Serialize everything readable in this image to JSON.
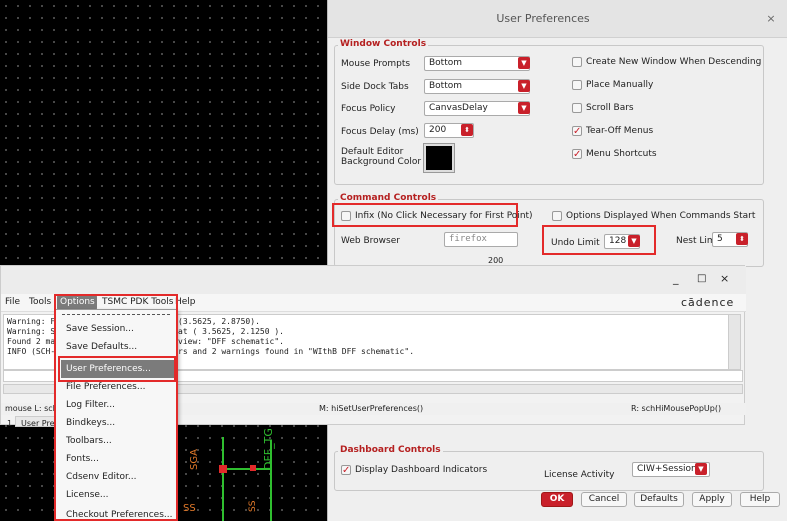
{
  "prefs": {
    "title": "User Preferences",
    "close": "×",
    "window_controls": {
      "title": "Window Controls",
      "mouse_prompts": {
        "label": "Mouse Prompts",
        "value": "Bottom"
      },
      "side_dock_tabs": {
        "label": "Side Dock Tabs",
        "value": "Bottom"
      },
      "focus_policy": {
        "label": "Focus Policy",
        "value": "CanvasDelay"
      },
      "focus_delay": {
        "label": "Focus Delay (ms)",
        "value": "200"
      },
      "bg_color": {
        "label1": "Default Editor",
        "label2": "Background Color"
      },
      "create_new_window": "Create New Window When Descending",
      "place_manually": "Place Manually",
      "scroll_bars": "Scroll Bars",
      "tear_off_menus": "Tear-Off Menus",
      "menu_shortcuts": "Menu Shortcuts"
    },
    "command_controls": {
      "title": "Command Controls",
      "infix": "Infix (No Click Necessary for First Point)",
      "options_displayed": "Options Displayed When Commands Start",
      "web_browser": {
        "label": "Web Browser",
        "value": "firefox"
      },
      "undo_limit": {
        "label": "Undo Limit",
        "value": "128"
      },
      "nest_limit": {
        "label": "Nest Limit",
        "value": "5"
      },
      "slider_value": "200"
    },
    "dashboard_controls": {
      "title": "Dashboard Controls",
      "display_indicators": "Display Dashboard Indicators",
      "license_activity": {
        "label": "License Activity",
        "value": "CIW+Session"
      }
    },
    "buttons": {
      "ok": "OK",
      "cancel": "Cancel",
      "defaults": "Defaults",
      "apply": "Apply",
      "help": "Help"
    }
  },
  "ciw": {
    "win_min": "_",
    "win_max": "□",
    "win_close": "×",
    "menus": [
      "File",
      "Tools",
      "Options",
      "TSMC PDK Tools",
      "Help"
    ],
    "brand": "cādence",
    "log": [
      "Warning: F",
      "Warning: S",
      "Found 2 ma",
      "INFO (SCH-"
    ],
    "log_right": [
      "(3.5625, 2.8750).",
      "at ( 3.5625, 2.1250 ).",
      "view: \"DFF schematic\".",
      "rs and 2 warnings found in \"WIthB DFF schematic\"."
    ],
    "status_left": "mouse L: sch",
    "status_mid": "M: hiSetUserPreferences()",
    "status_right": "R: schHiMousePopUp()",
    "tab_num": "1",
    "tab_label": "User Pref"
  },
  "options_menu": {
    "items": [
      "Save Session...",
      "Save Defaults...",
      "User Preferences...",
      "File Preferences...",
      "Log Filter...",
      "Bindkeys...",
      "Toolbars...",
      "Fonts...",
      "Cdsenv Editor...",
      "License...",
      "Checkout Preferences..."
    ]
  },
  "schematic": {
    "label_a": "DFF_TG",
    "label_b": "SGA",
    "label_c": "SS",
    "label_d": "SS"
  },
  "colors": {
    "accent": "#c9202a",
    "highlight": "#e32a2a",
    "menu_selected": "#7b7b7b"
  }
}
